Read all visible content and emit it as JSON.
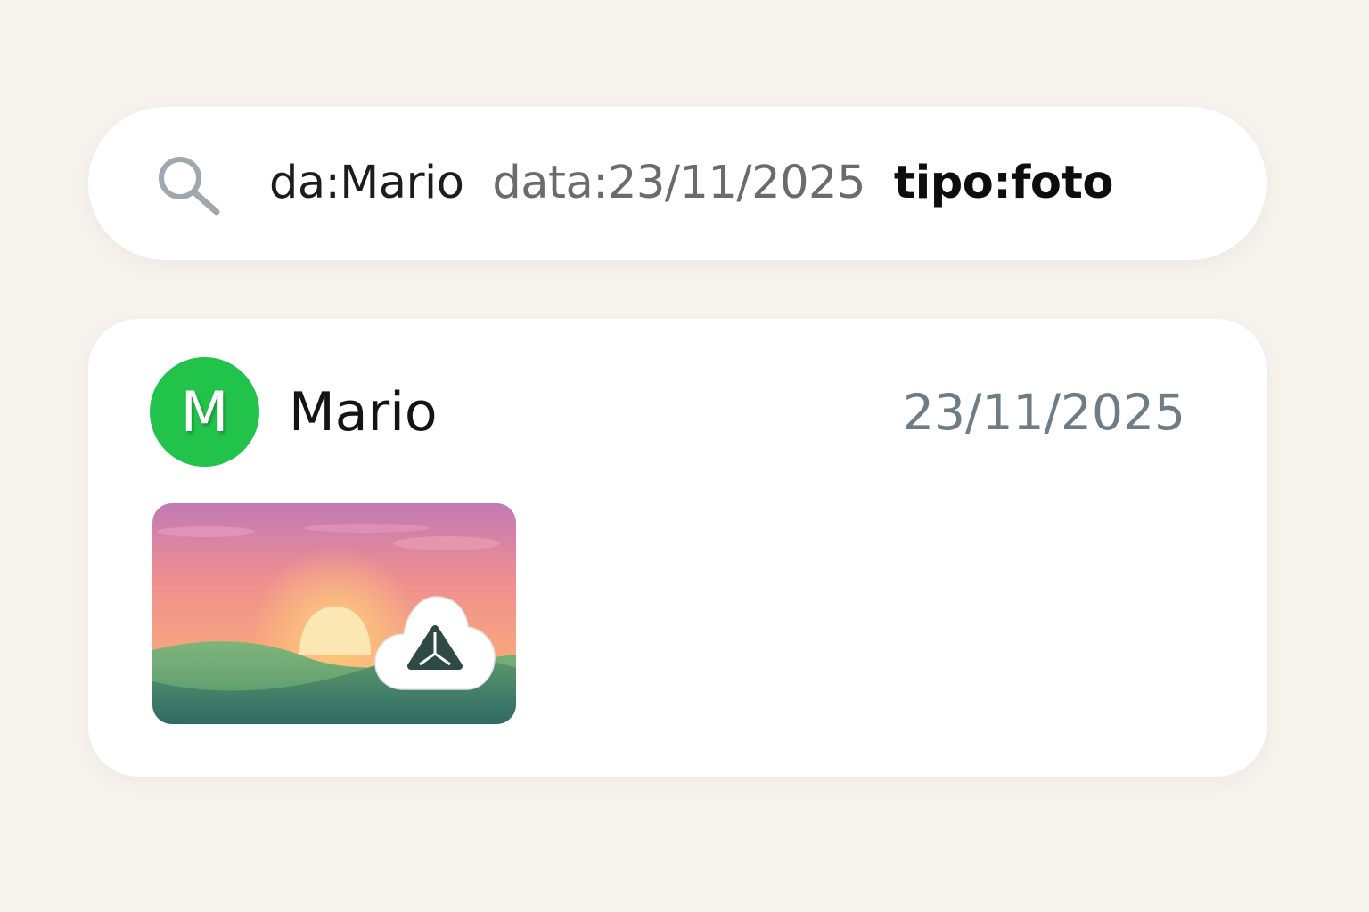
{
  "search": {
    "query_tokens": {
      "from": "da:Mario",
      "date": "data:23/11/2025",
      "type": "tipo:foto"
    }
  },
  "result": {
    "avatar_initial": "M",
    "sender": "Mario",
    "date": "23/11/2025",
    "attachment_icon": "cloud-upload-icon",
    "thumbnail": "sunset-landscape-photo"
  },
  "colors": {
    "background": "#f7f3ee",
    "avatar": "#22c34a",
    "date_text": "#6e7c86"
  }
}
